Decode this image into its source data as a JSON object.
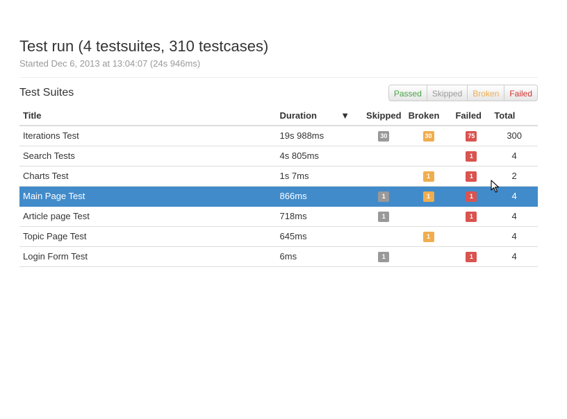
{
  "header": {
    "title": "Test run (4 testsuites, 310 testcases)",
    "subtitle": "Started Dec 6, 2013 at 13:04:07 (24s 946ms)"
  },
  "suites": {
    "heading": "Test Suites",
    "filters": [
      "Passed",
      "Skipped",
      "Broken",
      "Failed"
    ],
    "columns": {
      "title": "Title",
      "duration": "Duration",
      "sort_indicator": "▼",
      "skipped": "Skipped",
      "broken": "Broken",
      "failed": "Failed",
      "total": "Total"
    },
    "rows": [
      {
        "title": "Iterations Test",
        "duration": "19s 988ms",
        "skipped": "30",
        "broken": "30",
        "failed": "75",
        "total": "300",
        "selected": false
      },
      {
        "title": "Search Tests",
        "duration": "4s 805ms",
        "skipped": "",
        "broken": "",
        "failed": "1",
        "total": "4",
        "selected": false
      },
      {
        "title": "Charts Test",
        "duration": "1s 7ms",
        "skipped": "",
        "broken": "1",
        "failed": "1",
        "total": "2",
        "selected": false
      },
      {
        "title": "Main Page Test",
        "duration": "866ms",
        "skipped": "1",
        "broken": "1",
        "failed": "1",
        "total": "4",
        "selected": true
      },
      {
        "title": "Article page Test",
        "duration": "718ms",
        "skipped": "1",
        "broken": "",
        "failed": "1",
        "total": "4",
        "selected": false
      },
      {
        "title": "Topic Page Test",
        "duration": "645ms",
        "skipped": "",
        "broken": "1",
        "failed": "",
        "total": "4",
        "selected": false
      },
      {
        "title": "Login Form Test",
        "duration": "6ms",
        "skipped": "1",
        "broken": "",
        "failed": "1",
        "total": "4",
        "selected": false
      }
    ]
  },
  "colors": {
    "selected_row": "#428bca",
    "passed": "#47a447",
    "skipped": "#999999",
    "broken": "#f0ad4e",
    "failed": "#d9534f"
  },
  "icons": {
    "sort": "sort-desc-icon",
    "cursor": "mouse-pointer-icon"
  }
}
